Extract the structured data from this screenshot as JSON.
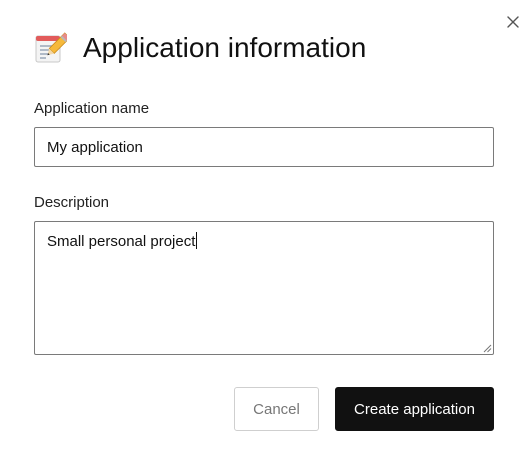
{
  "dialog": {
    "title": "Application information",
    "title_icon": "memo-pencil-icon",
    "close_icon": "close-icon"
  },
  "form": {
    "name_label": "Application name",
    "name_value": "My application",
    "description_label": "Description",
    "description_value": "Small personal project"
  },
  "actions": {
    "cancel_label": "Cancel",
    "create_label": "Create application"
  },
  "colors": {
    "primary_button_bg": "#111111",
    "primary_button_text": "#ffffff",
    "secondary_button_text": "#777777",
    "input_border": "#7a7a7a"
  }
}
